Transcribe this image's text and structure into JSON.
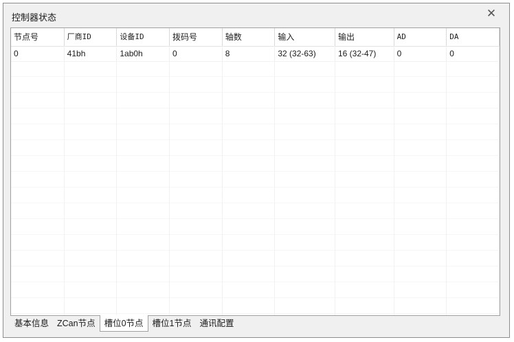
{
  "window": {
    "title": "控制器状态",
    "close_glyph": "✕"
  },
  "table": {
    "columns": [
      "节点号",
      "厂商ID",
      "设备ID",
      "拨码号",
      "轴数",
      "输入",
      "输出",
      "AD",
      "DA"
    ],
    "rows": [
      [
        "0",
        "41bh",
        "1ab0h",
        "0",
        "8",
        "32 (32-63)",
        "16 (32-47)",
        "0",
        "0"
      ]
    ]
  },
  "tabs": [
    {
      "label": "基本信息",
      "active": false
    },
    {
      "label": "ZCan节点",
      "active": false
    },
    {
      "label": "槽位0节点",
      "active": true
    },
    {
      "label": "槽位1节点",
      "active": false
    },
    {
      "label": "通讯配置",
      "active": false
    }
  ]
}
